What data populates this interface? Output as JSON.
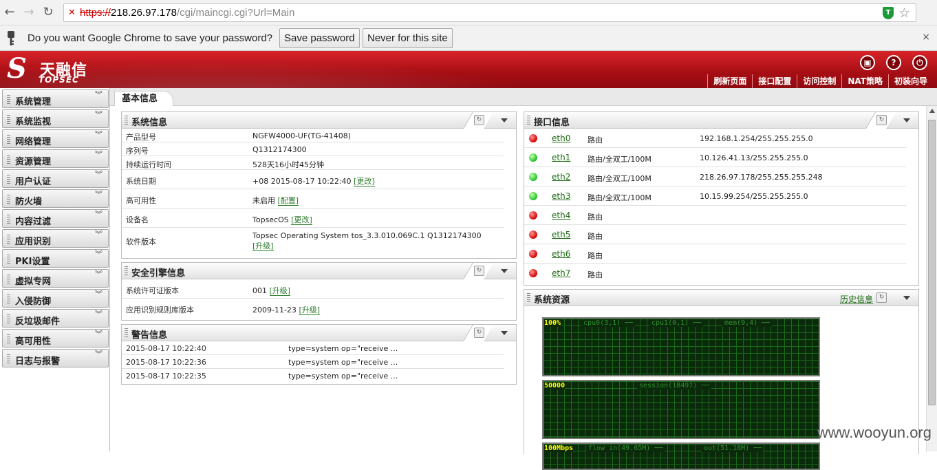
{
  "browser": {
    "url_proto": "https://",
    "url_host": "218.26.97.178",
    "url_path": "/cgi/maincgi.cgi?Url=Main"
  },
  "password_bar": {
    "message": "Do you want Google Chrome to save your password?",
    "save_label": "Save password",
    "never_label": "Never for this site",
    "close": "×"
  },
  "header": {
    "logo_cn": "天融信",
    "logo_en": "TOPSEC",
    "nav": [
      "刷新页面",
      "接口配置",
      "访问控制",
      "NAT策略",
      "初装向导"
    ]
  },
  "sidebar": {
    "items": [
      "系统管理",
      "系统监视",
      "网络管理",
      "资源管理",
      "用户认证",
      "防火墙",
      "内容过滤",
      "应用识别",
      "PKI设置",
      "虚拟专网",
      "入侵防御",
      "反垃圾邮件",
      "高可用性",
      "日志与报警"
    ]
  },
  "tab": {
    "label": "基本信息"
  },
  "system_info": {
    "title": "系统信息",
    "rows": [
      {
        "k": "产品型号",
        "v": "NGFW4000-UF(TG-41408)",
        "link": ""
      },
      {
        "k": "序列号",
        "v": "Q1312174300",
        "link": ""
      },
      {
        "k": "持续运行时间",
        "v": "528天16小时45分钟",
        "link": ""
      },
      {
        "k": "系统日期",
        "v": "+08 2015-08-17 10:22:40 ",
        "link": "[更改]"
      },
      {
        "k": "高可用性",
        "v": "未启用 ",
        "link": "[配置]"
      },
      {
        "k": "设备名",
        "v": "TopsecOS ",
        "link": "[更改]"
      },
      {
        "k": "软件版本",
        "v": "Topsec Operating System tos_3.3.010.069C.1 Q1312174300",
        "link": "[升级]"
      }
    ]
  },
  "engine_info": {
    "title": "安全引擎信息",
    "rows": [
      {
        "k": "系统许可证版本",
        "v": "001 ",
        "link": "[升级]"
      },
      {
        "k": "应用识别规则库版本",
        "v": "2009-11-23 ",
        "link": "[升级]"
      }
    ]
  },
  "alarm_info": {
    "title": "警告信息",
    "rows": [
      {
        "k": "2015-08-17 10:22:40",
        "v": "type=system op=\"receive ..."
      },
      {
        "k": "2015-08-17 10:22:36",
        "v": "type=system op=\"receive ..."
      },
      {
        "k": "2015-08-17 10:22:35",
        "v": "type=system op=\"receive ..."
      }
    ]
  },
  "interface_info": {
    "title": "接口信息",
    "rows": [
      {
        "name": "eth0",
        "status": "red",
        "mode": "路由",
        "ip": "192.168.1.254/255.255.255.0"
      },
      {
        "name": "eth1",
        "status": "green",
        "mode": "路由/全双工/100M",
        "ip": "10.126.41.13/255.255.255.0"
      },
      {
        "name": "eth2",
        "status": "green",
        "mode": "路由/全双工/100M",
        "ip": "218.26.97.178/255.255.255.248"
      },
      {
        "name": "eth3",
        "status": "green",
        "mode": "路由/全双工/100M",
        "ip": "10.15.99.254/255.255.255.0"
      },
      {
        "name": "eth4",
        "status": "red",
        "mode": "路由",
        "ip": ""
      },
      {
        "name": "eth5",
        "status": "red",
        "mode": "路由",
        "ip": ""
      },
      {
        "name": "eth6",
        "status": "red",
        "mode": "路由",
        "ip": ""
      },
      {
        "name": "eth7",
        "status": "red",
        "mode": "路由",
        "ip": ""
      }
    ]
  },
  "resources": {
    "title": "系统资源",
    "history_link": "历史信息",
    "graphs": [
      {
        "max": "100%",
        "legend": [
          "cpu0(3,1) ──",
          "cpu1(0,1) ──",
          "mem(9,4) ──"
        ]
      },
      {
        "max": "50000",
        "legend": [
          "session(18497) ──"
        ]
      },
      {
        "max": "100Mbps",
        "legend": [
          "flow in(49.65M) ──",
          "out(51.18M) ──"
        ]
      }
    ]
  },
  "watermark": "www.wooyun.org"
}
